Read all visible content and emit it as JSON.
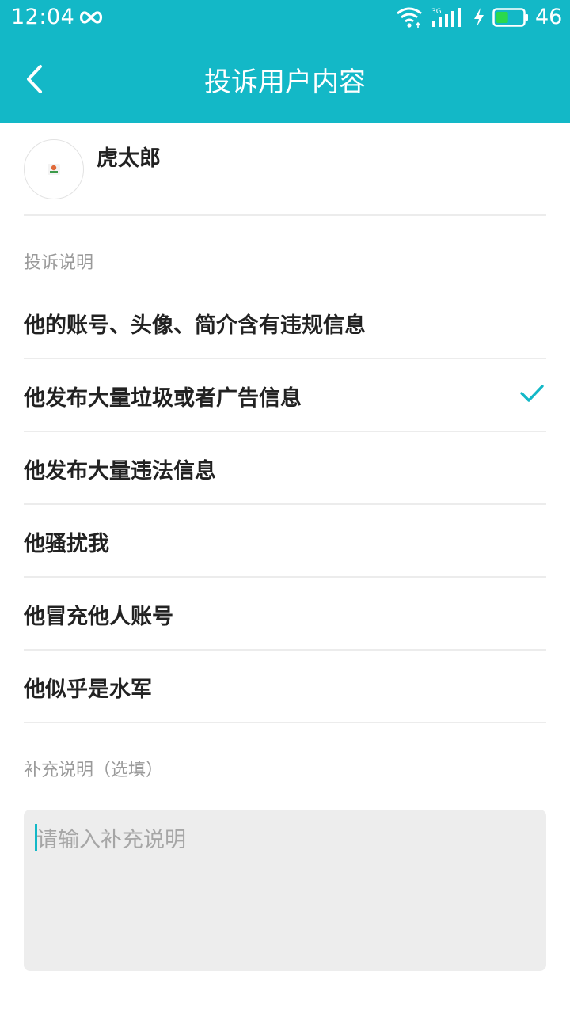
{
  "colors": {
    "accent": "#13b8c7",
    "divider": "#ececec",
    "input_bg": "#ededed"
  },
  "status_bar": {
    "time": "12:04",
    "network_badge": "3G",
    "battery_level": "46",
    "icons": [
      "infinity-icon",
      "wifi-icon",
      "signal-icon",
      "charge-icon",
      "battery-icon"
    ]
  },
  "header": {
    "title": "投诉用户内容",
    "back_icon": "chevron-left-icon"
  },
  "user": {
    "name": "虎太郎"
  },
  "reasons_section": {
    "label": "投诉说明",
    "items": [
      {
        "label": "他的账号、头像、简介含有违规信息",
        "selected": false
      },
      {
        "label": "他发布大量垃圾或者广告信息",
        "selected": true
      },
      {
        "label": "他发布大量违法信息",
        "selected": false
      },
      {
        "label": "他骚扰我",
        "selected": false
      },
      {
        "label": "他冒充他人账号",
        "selected": false
      },
      {
        "label": "他似乎是水军",
        "selected": false
      }
    ]
  },
  "note_section": {
    "label": "补充说明（选填）",
    "placeholder": "请输入补充说明",
    "value": ""
  }
}
